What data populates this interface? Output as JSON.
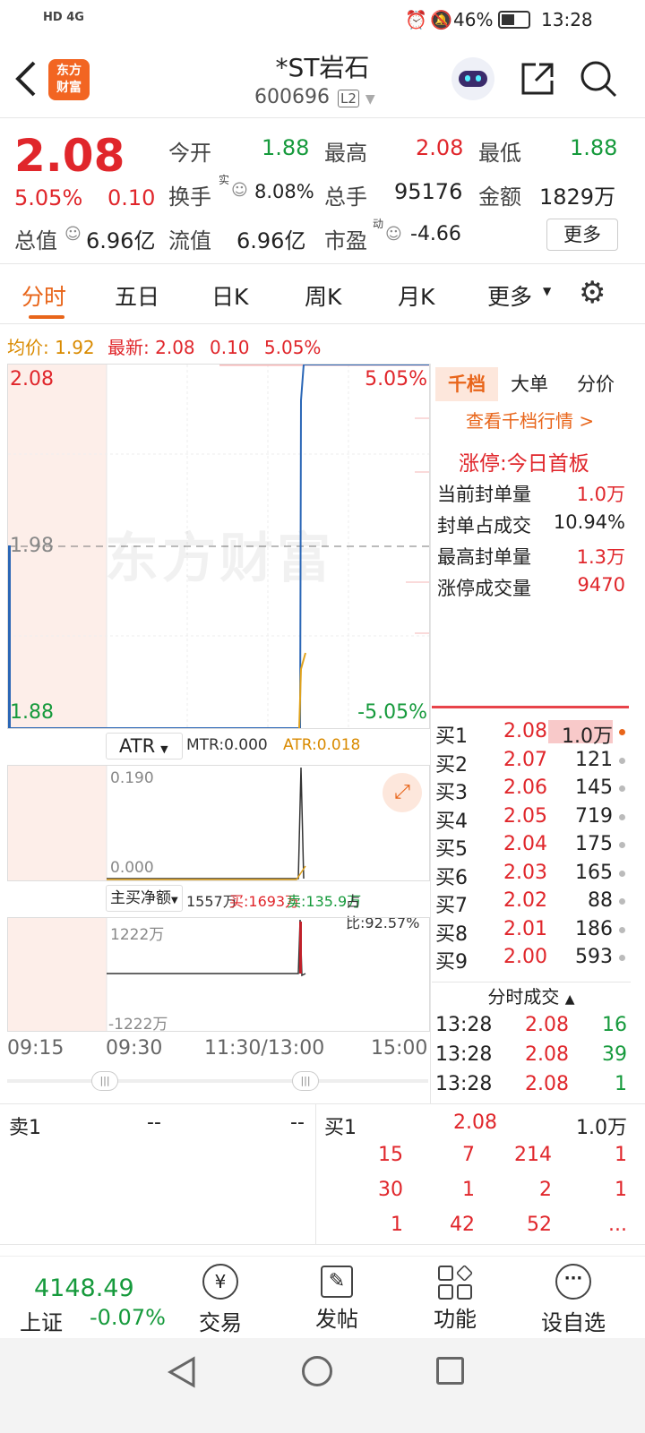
{
  "status_bar": {
    "left": "HD 4G",
    "battery": "46%",
    "time": "13:28"
  },
  "header": {
    "logo_top": "东方",
    "logo_bottom": "财富",
    "title": "*ST岩石",
    "code": "600696",
    "level": "L2"
  },
  "quote": {
    "price": "2.08",
    "change_pct": "5.05%",
    "change": "0.10",
    "row1": [
      {
        "label": "今开",
        "value": "1.88",
        "color": "green"
      },
      {
        "label": "最高",
        "value": "2.08",
        "color": "red"
      },
      {
        "label": "最低",
        "value": "1.88",
        "color": "green"
      }
    ],
    "row2": [
      {
        "label": "换手",
        "sup": "实",
        "value": "8.08%"
      },
      {
        "label": "总手",
        "value": "95176"
      },
      {
        "label": "金额",
        "value": "1829万"
      }
    ],
    "row3": [
      {
        "label": "总值",
        "value": "6.96亿"
      },
      {
        "label": "流值",
        "value": "6.96亿"
      },
      {
        "label": "市盈",
        "sup": "动",
        "value": "-4.66"
      }
    ],
    "more": "更多"
  },
  "tabs": [
    "分时",
    "五日",
    "日K",
    "周K",
    "月K",
    "更多"
  ],
  "avg_line": {
    "avg_label": "均价:",
    "avg": "1.92",
    "last_label": "最新:",
    "last": "2.08",
    "chg": "0.10",
    "pct": "5.05%"
  },
  "chart": {
    "y_top": "2.08",
    "y_mid": "1.98",
    "y_bottom": "1.88",
    "pct_top": "5.05%",
    "pct_bottom": "-5.05%",
    "watermark": "东方财富",
    "x_labels": [
      "09:15",
      "09:30",
      "11:30/13:00",
      "15:00"
    ]
  },
  "atr": {
    "name": "ATR",
    "mtr": "MTR:0.000",
    "atr": "ATR:0.018",
    "max": "0.190",
    "min": "0.000"
  },
  "flow": {
    "name": "主买净额",
    "total": "1557万",
    "buy": "买:1693万",
    "sell": "卖:135.9万",
    "ratio": "占比:92.57%",
    "max": "1222万",
    "min": "-1222万"
  },
  "side_tabs": [
    "千档",
    "大单",
    "分价"
  ],
  "side": {
    "link": "查看千档行情 >",
    "limit_title": "涨停:今日首板",
    "stats": [
      {
        "label": "当前封单量",
        "value": "1.0万"
      },
      {
        "label": "封单占成交",
        "value": "10.94%"
      },
      {
        "label": "最高封单量",
        "value": "1.3万"
      },
      {
        "label": "涨停成交量",
        "value": "9470"
      }
    ]
  },
  "bids": [
    {
      "label": "买1",
      "price": "2.08",
      "vol": "1.0万"
    },
    {
      "label": "买2",
      "price": "2.07",
      "vol": "121"
    },
    {
      "label": "买3",
      "price": "2.06",
      "vol": "145"
    },
    {
      "label": "买4",
      "price": "2.05",
      "vol": "719"
    },
    {
      "label": "买5",
      "price": "2.04",
      "vol": "175"
    },
    {
      "label": "买6",
      "price": "2.03",
      "vol": "165"
    },
    {
      "label": "买7",
      "price": "2.02",
      "vol": "88"
    },
    {
      "label": "买8",
      "price": "2.01",
      "vol": "186"
    },
    {
      "label": "买9",
      "price": "2.00",
      "vol": "593"
    }
  ],
  "ticks_title": "分时成交",
  "ticks": [
    {
      "time": "13:28",
      "price": "2.08",
      "vol": "16"
    },
    {
      "time": "13:28",
      "price": "2.08",
      "vol": "39"
    },
    {
      "time": "13:28",
      "price": "2.08",
      "vol": "1"
    }
  ],
  "queue": {
    "sell_label": "卖1",
    "sell_price": "--",
    "sell_vol": "--",
    "buy_label": "买1",
    "buy_price": "2.08",
    "buy_vol": "1.0万",
    "rows": [
      [
        "15",
        "7",
        "214",
        "1"
      ],
      [
        "30",
        "1",
        "2",
        "1"
      ],
      [
        "1",
        "42",
        "52",
        "..."
      ]
    ]
  },
  "bottom": {
    "index_value": "4148.49",
    "index_name": "上证",
    "index_chg": "-0.07%",
    "items": [
      "交易",
      "发帖",
      "功能",
      "设自选"
    ]
  }
}
